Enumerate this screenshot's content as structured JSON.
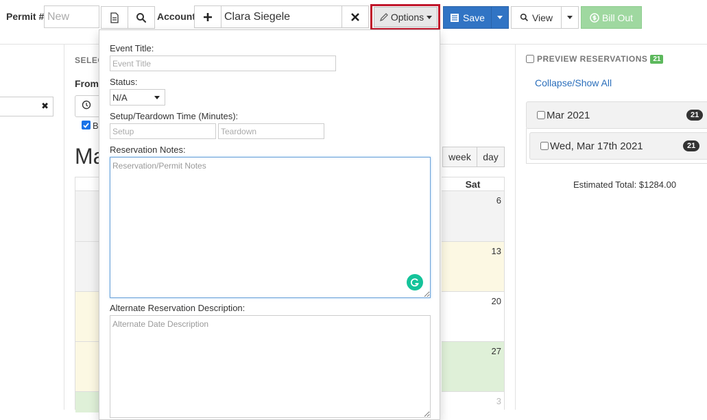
{
  "toolbar": {
    "permit_label": "Permit #",
    "permit_placeholder": "New",
    "account_label": "Account",
    "account_value": "Clara Siegele",
    "options_label": "Options",
    "save_label": "Save",
    "view_label": "View",
    "bill_out_label": "Bill Out"
  },
  "left_panel": {
    "select_heading": "SELEC",
    "from_label": "From",
    "month_title_fragment": "Ma",
    "checkbox_fragment": "B"
  },
  "calendar": {
    "view_buttons": [
      "week",
      "day"
    ],
    "sat_header": "Sat",
    "sat_days": [
      "6",
      "13",
      "20",
      "27",
      "3"
    ]
  },
  "options_dropdown": {
    "event_title_label": "Event Title:",
    "event_title_placeholder": "Event Title",
    "status_label": "Status:",
    "status_value": "N/A",
    "setup_teardown_label": "Setup/Teardown Time (Minutes):",
    "setup_placeholder": "Setup",
    "teardown_placeholder": "Teardown",
    "reservation_notes_label": "Reservation Notes:",
    "reservation_notes_placeholder": "Reservation/Permit Notes",
    "alternate_desc_label": "Alternate Reservation Description:",
    "alternate_desc_placeholder": "Alternate Date Description"
  },
  "preview": {
    "heading": "PREVIEW RESERVATIONS",
    "heading_count": "21",
    "collapse_link": "Collapse/Show All",
    "groups": [
      {
        "label": "Mar 2021",
        "count": "21"
      },
      {
        "label": "Wed, Mar 17th 2021",
        "count": "21"
      }
    ],
    "estimated_total": "Estimated Total: $1284.00"
  },
  "colors": {
    "primary": "#3174c4",
    "success_disabled": "#9fd8a0",
    "highlight": "#c0152a",
    "cal_yellow": "#fcf8e3",
    "cal_green": "#dff0d8",
    "cal_gray": "#f3f3f3",
    "grammarly": "#15c39a"
  }
}
